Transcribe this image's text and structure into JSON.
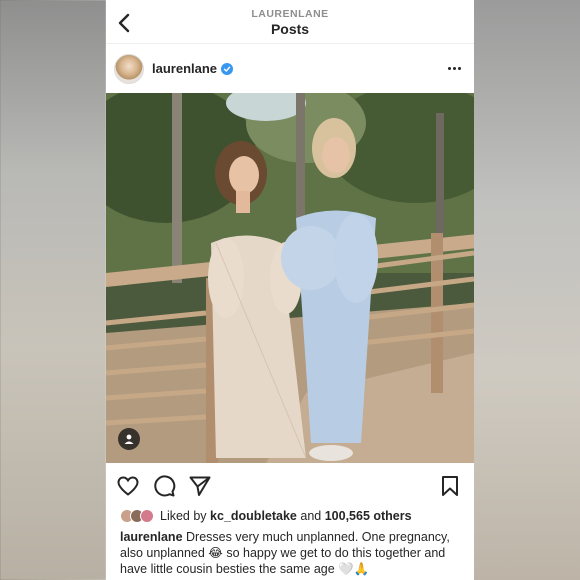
{
  "header": {
    "account_label": "LAURENLANE",
    "title": "Posts"
  },
  "post": {
    "username": "laurenlane",
    "verified": true,
    "liked_by_user": "kc_doubletake",
    "likes_count": "100,565 others",
    "liked_by_prefix": "Liked by",
    "and_word": "and",
    "caption_user": "laurenlane",
    "caption_text": "Dresses very much unplanned. One pregnancy, also unplanned 😂 so happy we get to do this together and have little cousin besties the same age 🤍🙏"
  },
  "icons": {
    "back": "chevron-left-icon",
    "more": "more-dots-icon",
    "like": "heart-icon",
    "comment": "comment-icon",
    "share": "send-icon",
    "save": "bookmark-icon",
    "tags": "user-tag-icon",
    "verified": "verified-badge-icon"
  },
  "colors": {
    "verified_blue": "#3897f0",
    "text": "#262626",
    "muted": "#8e8e8e"
  }
}
